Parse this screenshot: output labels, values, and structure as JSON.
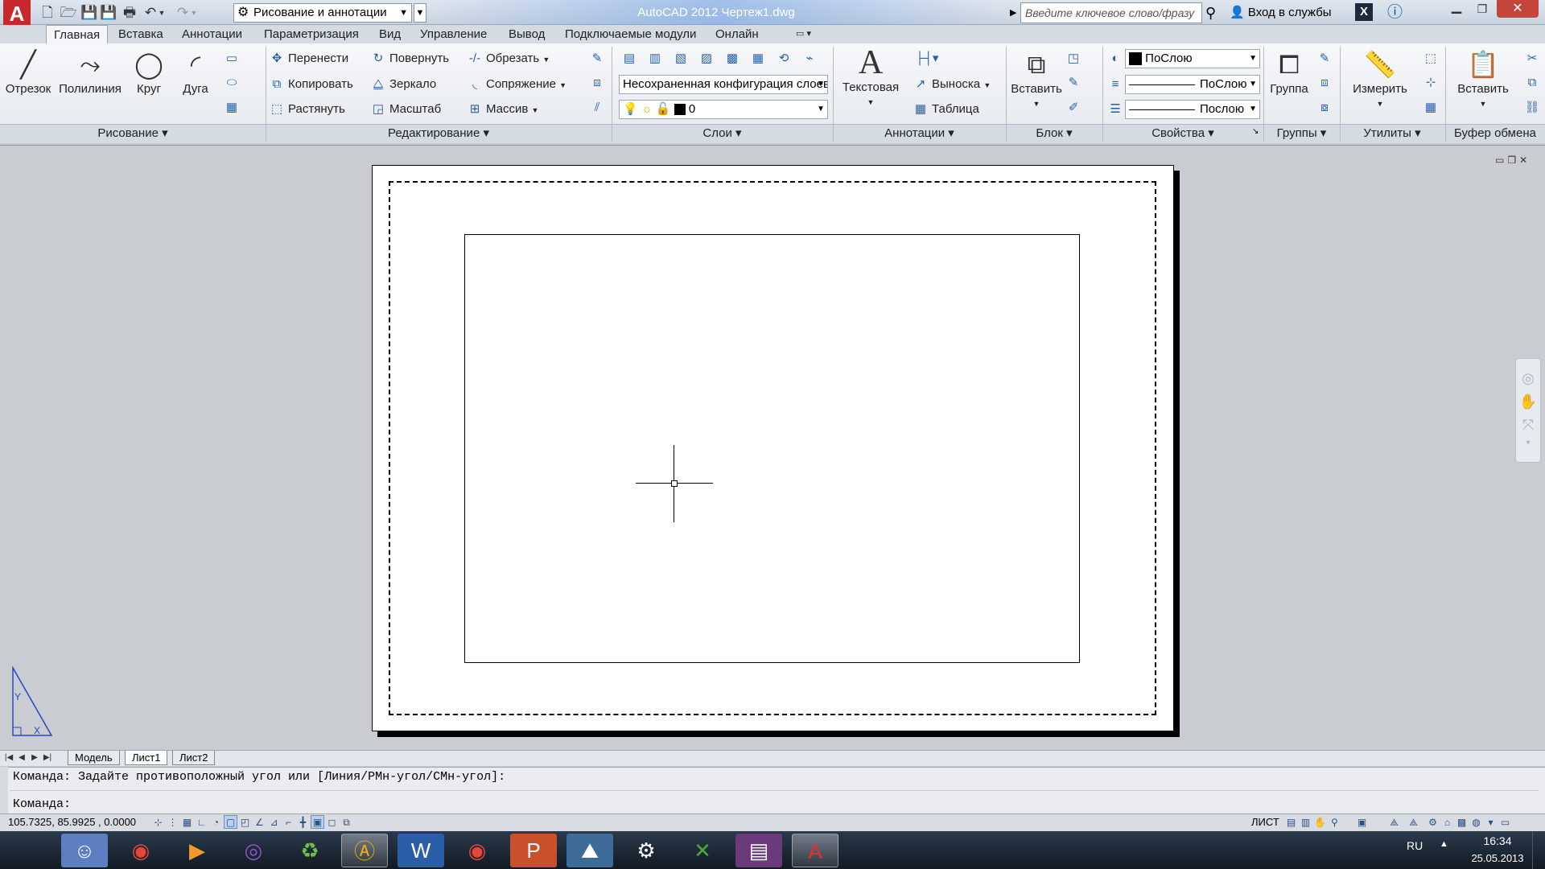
{
  "titlebar": {
    "app_icon": "autocad-logo-icon",
    "workspace": "Рисование и аннотации",
    "title": "AutoCAD 2012   Чертеж1.dwg",
    "search_placeholder": "Введите ключевое слово/фразу",
    "login": "Вход в службы"
  },
  "tabs": [
    "Главная",
    "Вставка",
    "Аннотации",
    "Параметризация",
    "Вид",
    "Управление",
    "Вывод",
    "Подключаемые модули",
    "Онлайн"
  ],
  "active_tab": "Главная",
  "ribbon": {
    "draw": {
      "title": "Рисование",
      "line": "Отрезок",
      "polyline": "Полилиния",
      "circle": "Круг",
      "arc": "Дуга"
    },
    "modify": {
      "title": "Редактирование",
      "move": "Перенести",
      "copy": "Копировать",
      "stretch": "Растянуть",
      "rotate": "Повернуть",
      "mirror": "Зеркало",
      "scale": "Масштаб",
      "trim": "Обрезать",
      "fillet": "Сопряжение",
      "array": "Массив"
    },
    "layers": {
      "title": "Слои",
      "state": "Несохраненная конфигурация слоев",
      "current": "0"
    },
    "annotation": {
      "title": "Аннотации",
      "text": "Текстовая",
      "leader": "Выноска",
      "table": "Таблица"
    },
    "block": {
      "title": "Блок",
      "insert": "Вставить"
    },
    "properties": {
      "title": "Свойства",
      "color": "ПоСлою",
      "lineweight": "ПоСлою",
      "linetype": "Послою"
    },
    "groups": {
      "title": "Группы",
      "group": "Группа"
    },
    "utilities": {
      "title": "Утилиты",
      "measure": "Измерить"
    },
    "clipboard": {
      "title": "Буфер обмена",
      "paste": "Вставить"
    }
  },
  "layout_tabs": [
    "Модель",
    "Лист1",
    "Лист2"
  ],
  "active_layout": "Лист1",
  "command": {
    "history": "Команда: Задайте противоположный угол или [Линия/РМн-угол/СМн-угол]:",
    "prompt": "Команда:"
  },
  "status": {
    "coords": "105.7325, 85.9925 , 0.0000",
    "space": "ЛИСТ"
  },
  "taskbar": {
    "apps": [
      "finder-icon",
      "chrome-icon",
      "media-player-icon",
      "torrent-icon",
      "cleaner-icon",
      "autocad-icon",
      "word-icon",
      "chrome-icon",
      "powerpoint-icon",
      "photo-viewer-icon",
      "steam-icon",
      "xrumer-icon",
      "winrar-icon",
      "autocad-icon"
    ],
    "lang": "RU",
    "time": "16:34",
    "date": "25.05.2013"
  },
  "colors": {
    "accent": "#c8282c",
    "ribbon": "#eef1f5",
    "drawing_bg": "#c9ccd1",
    "ucs": "#2848c8"
  }
}
